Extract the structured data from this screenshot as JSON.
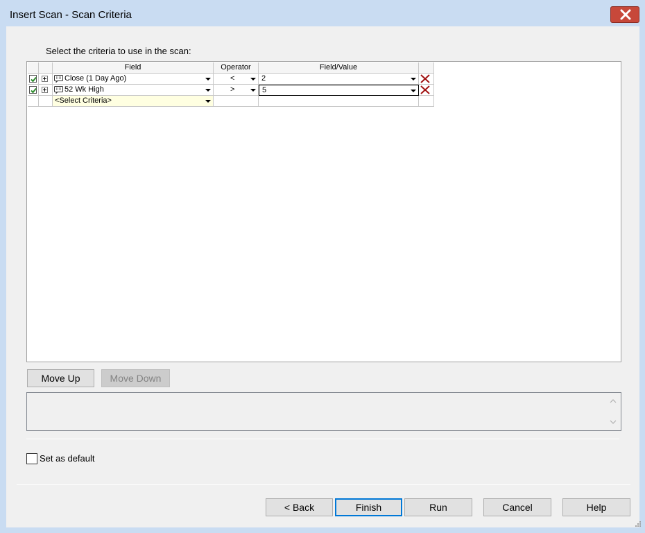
{
  "window": {
    "title": "Insert Scan - Scan Criteria"
  },
  "instruction": "Select the criteria to use in the scan:",
  "grid": {
    "headers": {
      "field": "Field",
      "operator": "Operator",
      "value": "Field/Value"
    },
    "rows": [
      {
        "checked": true,
        "field": "Close (1 Day Ago)",
        "operator": "<",
        "value": "2"
      },
      {
        "checked": true,
        "field": "52 Wk High",
        "operator": ">",
        "value": "5"
      }
    ],
    "new_row": {
      "field": "<Select Criteria>"
    }
  },
  "buttons": {
    "move_up": "Move Up",
    "move_down": "Move Down",
    "back": "< Back",
    "finish": "Finish",
    "run": "Run",
    "cancel": "Cancel",
    "help": "Help"
  },
  "default_checkbox": {
    "label": "Set as default",
    "checked": false
  },
  "icons": {
    "close": "close-icon",
    "check": "check-icon",
    "expand": "plus-icon",
    "field": "field-icon",
    "delete": "delete-x-icon",
    "dropdown": "chevron-down-icon"
  },
  "colors": {
    "titlebar": "#c9dcf2",
    "close_button": "#c7483a",
    "check_green": "#2a8a2a",
    "delete_red": "#a01010",
    "select_criteria_bg": "#ffffe1"
  }
}
